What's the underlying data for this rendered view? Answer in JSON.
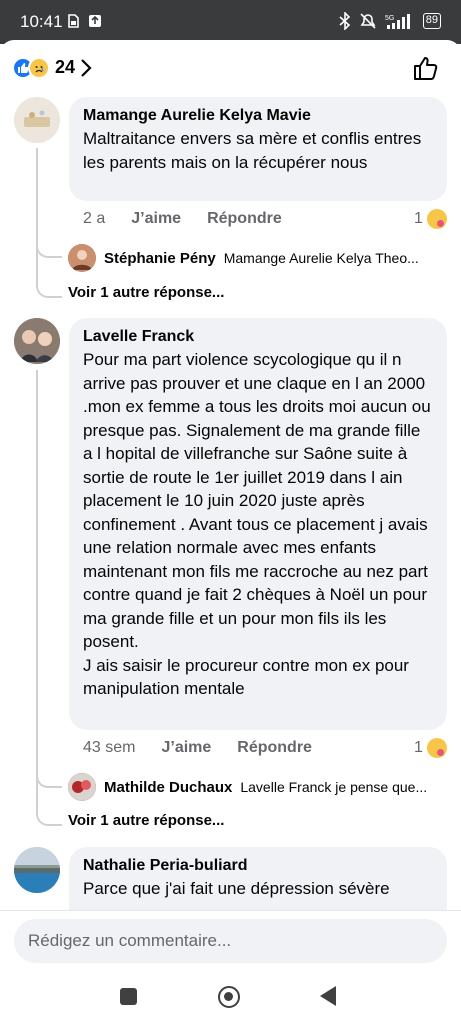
{
  "status_bar": {
    "time": "10:41",
    "battery": "89",
    "icons": [
      "sim-icon",
      "app-icon",
      "bluetooth-icon",
      "mute-icon",
      "5g-signal-icon",
      "wifi-icon",
      "battery-icon"
    ]
  },
  "reactions": {
    "count": "24",
    "types": [
      "like",
      "sad"
    ]
  },
  "comments": [
    {
      "author": "Mamange Aurelie Kelya Mavie",
      "text": "Maltraitance envers sa mère et conflis entres les parents mais on la récupérer nous",
      "time": "2 a",
      "like_label": "J’aime",
      "reply_label": "Répondre",
      "reaction_count": "1",
      "reply": {
        "author": "Stéphanie Pény",
        "text": "Mamange Aurelie Kelya Theo..."
      },
      "more_replies": "Voir 1 autre réponse..."
    },
    {
      "author": "Lavelle Franck",
      "text": "Pour ma part violence scycologique qu il n arrive pas prouver et une claque en l an 2000 .mon ex femme a tous les droits moi aucun ou presque pas. Signalement de ma grande fille a l hopital de villefranche sur Saône suite à sortie de route le 1er juillet 2019 dans l ain placement le 10 juin 2020 juste après confinement . Avant tous ce placement j avais une relation normale avec mes enfants maintenant mon fils me raccroche au nez part contre quand je fait 2 chèques à Noël un pour ma grande fille et un pour mon fils ils les posent.\nJ ais saisir le procureur contre mon ex pour manipulation mentale",
      "time": "43 sem",
      "like_label": "J’aime",
      "reply_label": "Répondre",
      "reaction_count": "1",
      "reply": {
        "author": "Mathilde Duchaux",
        "text": "Lavelle Franck je pense que..."
      },
      "more_replies": "Voir 1 autre réponse..."
    },
    {
      "author": "Nathalie Peria-buliard",
      "text": "Parce que j'ai fait une dépression sévère"
    }
  ],
  "compose": {
    "placeholder": "Rédigez un commentaire..."
  },
  "colors": {
    "accent": "#1877f2",
    "bubble": "#f0f2f5",
    "meta": "#65676b"
  }
}
